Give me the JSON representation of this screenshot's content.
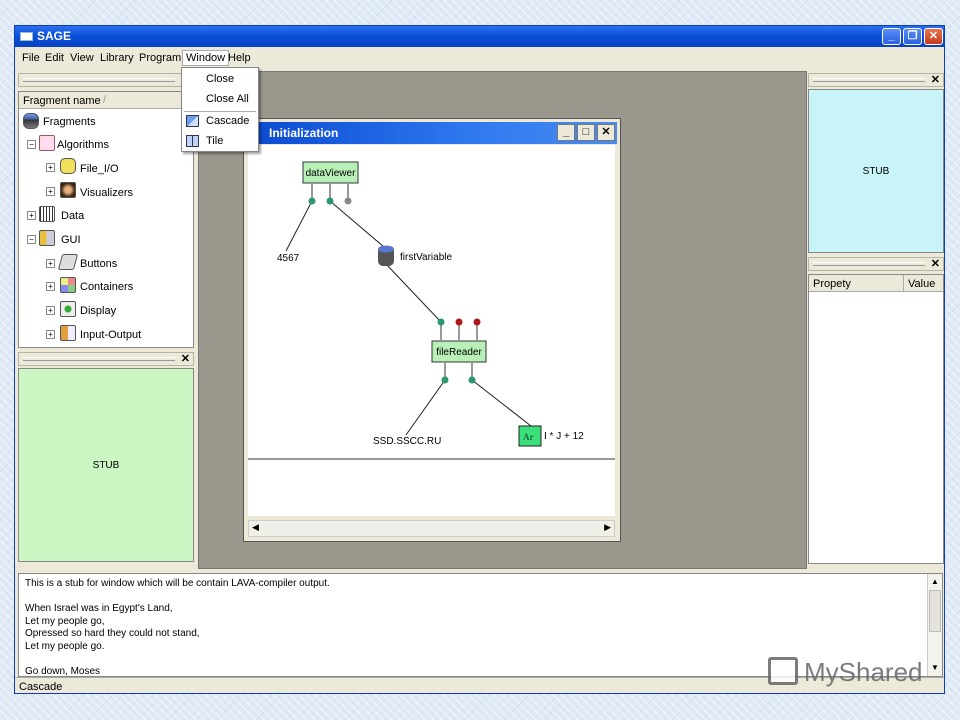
{
  "app": {
    "title": "SAGE"
  },
  "menu": {
    "items": [
      "File",
      "Edit",
      "View",
      "Library",
      "Program",
      "Window",
      "Help"
    ],
    "window_dropdown": [
      {
        "label": "Close",
        "icon": ""
      },
      {
        "label": "Close All",
        "icon": ""
      },
      {
        "label": "Cascade",
        "icon": "cascade-icon"
      },
      {
        "label": "Tile",
        "icon": "tile-icon"
      }
    ]
  },
  "tree": {
    "header": "Fragment name",
    "items": [
      {
        "label": "Fragments",
        "icon": "database-icon",
        "color": "#4a6fc0"
      },
      {
        "label": "Algorithms",
        "icon": "algorithm-icon",
        "color": "#e07070"
      },
      {
        "label": "File_I/O",
        "icon": "file-io-icon",
        "color": "#f2e05a"
      },
      {
        "label": "Visualizers",
        "icon": "mona-lisa-icon",
        "color": "#7a4a20"
      },
      {
        "label": "Data",
        "icon": "data-grid-icon",
        "color": "#555555"
      },
      {
        "label": "GUI",
        "icon": "gui-icon",
        "color": "#e8c040"
      },
      {
        "label": "Buttons",
        "icon": "button-key-icon",
        "color": "#cccccc"
      },
      {
        "label": "Containers",
        "icon": "containers-icon",
        "color": "#8ac080"
      },
      {
        "label": "Display",
        "icon": "display-icon",
        "color": "#60a040"
      },
      {
        "label": "Input-Output",
        "icon": "input-output-icon",
        "color": "#e0a040"
      }
    ]
  },
  "left_stub": {
    "label": "STUB",
    "color": "#ccf5c4"
  },
  "right_stub": {
    "label": "STUB",
    "color": "#c8f4f8"
  },
  "properties": {
    "columns": [
      "Propety",
      "Value"
    ]
  },
  "editor": {
    "title": "Initialization",
    "nodes": {
      "dataViewer": "dataViewer",
      "fileReader": "fileReader"
    },
    "labels": {
      "constant": "4567",
      "variable": "firstVariable",
      "host": "SSD.SSCC.RU",
      "expression": "I * J + 12",
      "expr_icon": "Ar"
    },
    "colors": {
      "node_fill": "#b8f0b8",
      "port_connected": "#2a9a6a",
      "port_unconnected": "#888888",
      "port_error": "#b01818"
    }
  },
  "output": {
    "lines": [
      "This is a stub for window which will be contain LAVA-compiler output.",
      "",
      "When Israel was in Egypt's Land,",
      "Let my people go,",
      "Opressed so hard they could not stand,",
      "Let my people go.",
      "",
      "Go down, Moses"
    ]
  },
  "status": {
    "text": "Cascade"
  },
  "watermark": {
    "text": "MyShared"
  }
}
